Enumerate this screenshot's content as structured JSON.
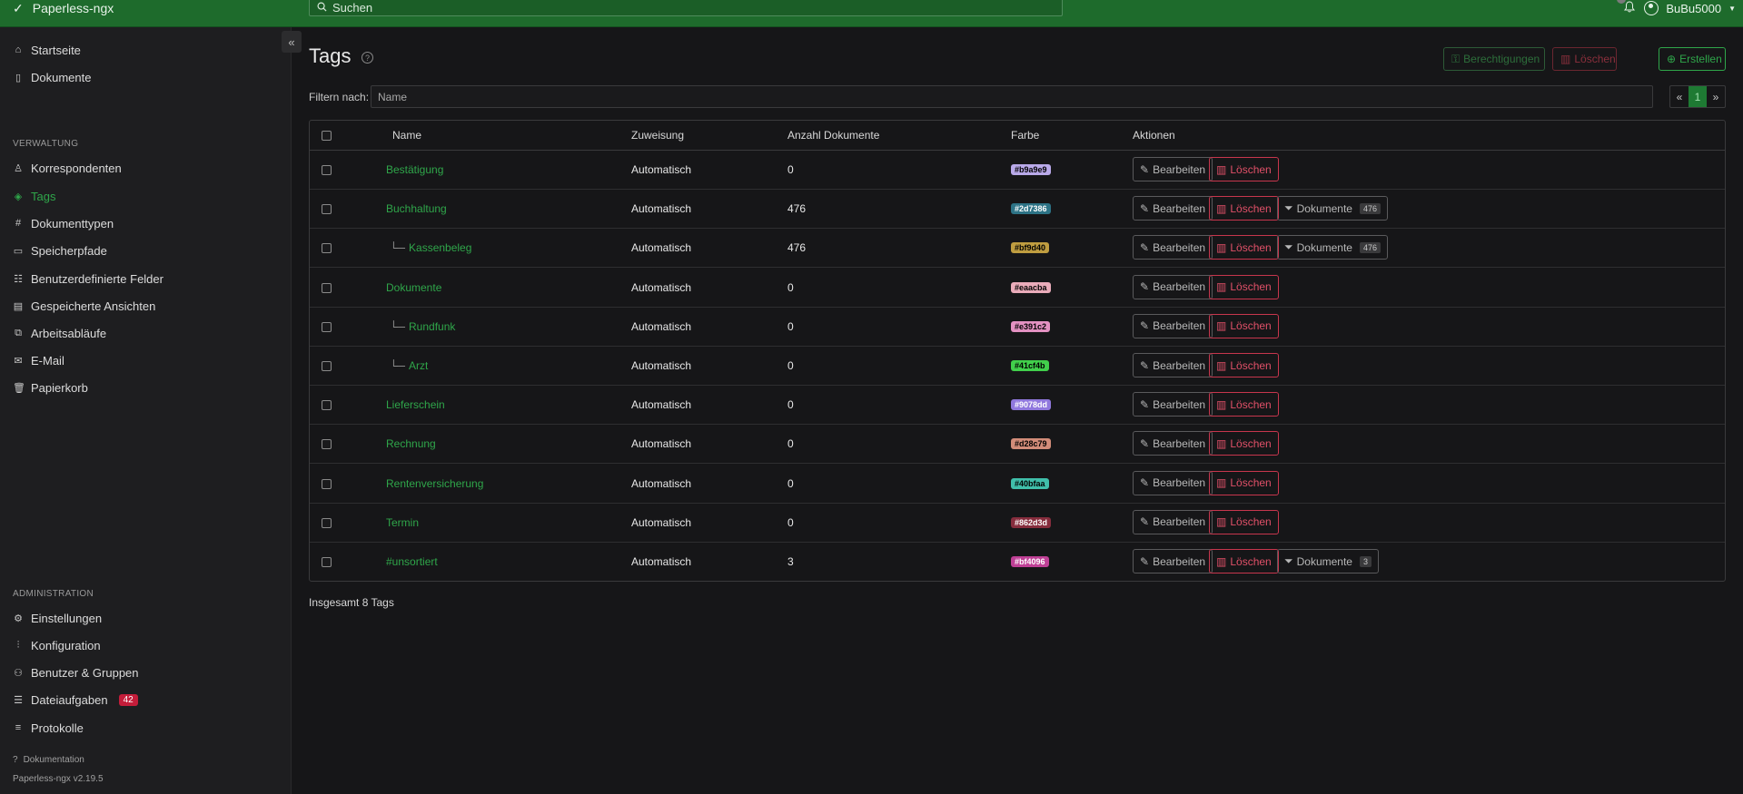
{
  "app": {
    "name": "Paperless-ngx",
    "search_placeholder": "Suchen",
    "user": "BuBu5000"
  },
  "sidebar": {
    "main": [
      {
        "label": "Startseite",
        "icon": "house-icon"
      },
      {
        "label": "Dokumente",
        "icon": "document-icon"
      }
    ],
    "verwaltung_heading": "VERWALTUNG",
    "verwaltung": [
      {
        "label": "Korrespondenten",
        "icon": "person-icon"
      },
      {
        "label": "Tags",
        "icon": "tag-icon",
        "active": true
      },
      {
        "label": "Dokumenttypen",
        "icon": "hash-icon"
      },
      {
        "label": "Speicherpfade",
        "icon": "folder-icon"
      },
      {
        "label": "Benutzerdefinierte Felder",
        "icon": "ui-checks-icon"
      },
      {
        "label": "Gespeicherte Ansichten",
        "icon": "window-icon"
      },
      {
        "label": "Arbeitsabläufe",
        "icon": "boxes-icon"
      },
      {
        "label": "E-Mail",
        "icon": "envelope-icon"
      },
      {
        "label": "Papierkorb",
        "icon": "trash-icon"
      }
    ],
    "admin_heading": "ADMINISTRATION",
    "admin": [
      {
        "label": "Einstellungen",
        "icon": "gear-icon"
      },
      {
        "label": "Konfiguration",
        "icon": "sliders-icon"
      },
      {
        "label": "Benutzer & Gruppen",
        "icon": "people-icon"
      },
      {
        "label": "Dateiaufgaben",
        "icon": "list-task-icon",
        "badge": "42"
      },
      {
        "label": "Protokolle",
        "icon": "text-left-icon"
      }
    ],
    "doc_link": "Dokumentation",
    "version": "Paperless-ngx v2.19.5"
  },
  "page": {
    "title": "Tags",
    "btn_permissions": "Berechtigungen",
    "btn_delete": "Löschen",
    "btn_create": "Erstellen",
    "filter_label": "Filtern nach:",
    "filter_placeholder": "Name",
    "pager": {
      "prev": "«",
      "current": "1",
      "next": "»"
    },
    "total": "Insgesamt 8 Tags"
  },
  "table": {
    "headers": {
      "name": "Name",
      "assign": "Zuweisung",
      "count": "Anzahl Dokumente",
      "color": "Farbe",
      "actions": "Aktionen"
    },
    "action_labels": {
      "edit": "Bearbeiten",
      "delete": "Löschen",
      "docs": "Dokumente"
    },
    "rows": [
      {
        "name": "Bestätigung",
        "child": false,
        "assign": "Automatisch",
        "count": "0",
        "color": "#b9a9e9",
        "text_color": "#000000"
      },
      {
        "name": "Buchhaltung",
        "child": false,
        "assign": "Automatisch",
        "count": "476",
        "color": "#2d7386",
        "text_color": "#ffffff",
        "docs": "476"
      },
      {
        "name": "Kassenbeleg",
        "child": true,
        "assign": "Automatisch",
        "count": "476",
        "color": "#bf9d40",
        "text_color": "#000000",
        "docs": "476"
      },
      {
        "name": "Dokumente",
        "child": false,
        "assign": "Automatisch",
        "count": "0",
        "color": "#eaacba",
        "text_color": "#000000"
      },
      {
        "name": "Rundfunk",
        "child": true,
        "assign": "Automatisch",
        "count": "0",
        "color": "#e391c2",
        "text_color": "#000000"
      },
      {
        "name": "Arzt",
        "child": true,
        "assign": "Automatisch",
        "count": "0",
        "color": "#41cf4b",
        "text_color": "#000000"
      },
      {
        "name": "Lieferschein",
        "child": false,
        "assign": "Automatisch",
        "count": "0",
        "color": "#9078dd",
        "text_color": "#ffffff"
      },
      {
        "name": "Rechnung",
        "child": false,
        "assign": "Automatisch",
        "count": "0",
        "color": "#d28c79",
        "text_color": "#000000"
      },
      {
        "name": "Rentenversicherung",
        "child": false,
        "assign": "Automatisch",
        "count": "0",
        "color": "#40bfaa",
        "text_color": "#000000"
      },
      {
        "name": "Termin",
        "child": false,
        "assign": "Automatisch",
        "count": "0",
        "color": "#862d3d",
        "text_color": "#ffffff"
      },
      {
        "name": "#unsortiert",
        "child": false,
        "assign": "Automatisch",
        "count": "3",
        "color": "#bf4096",
        "text_color": "#ffffff",
        "docs": "3"
      }
    ]
  }
}
